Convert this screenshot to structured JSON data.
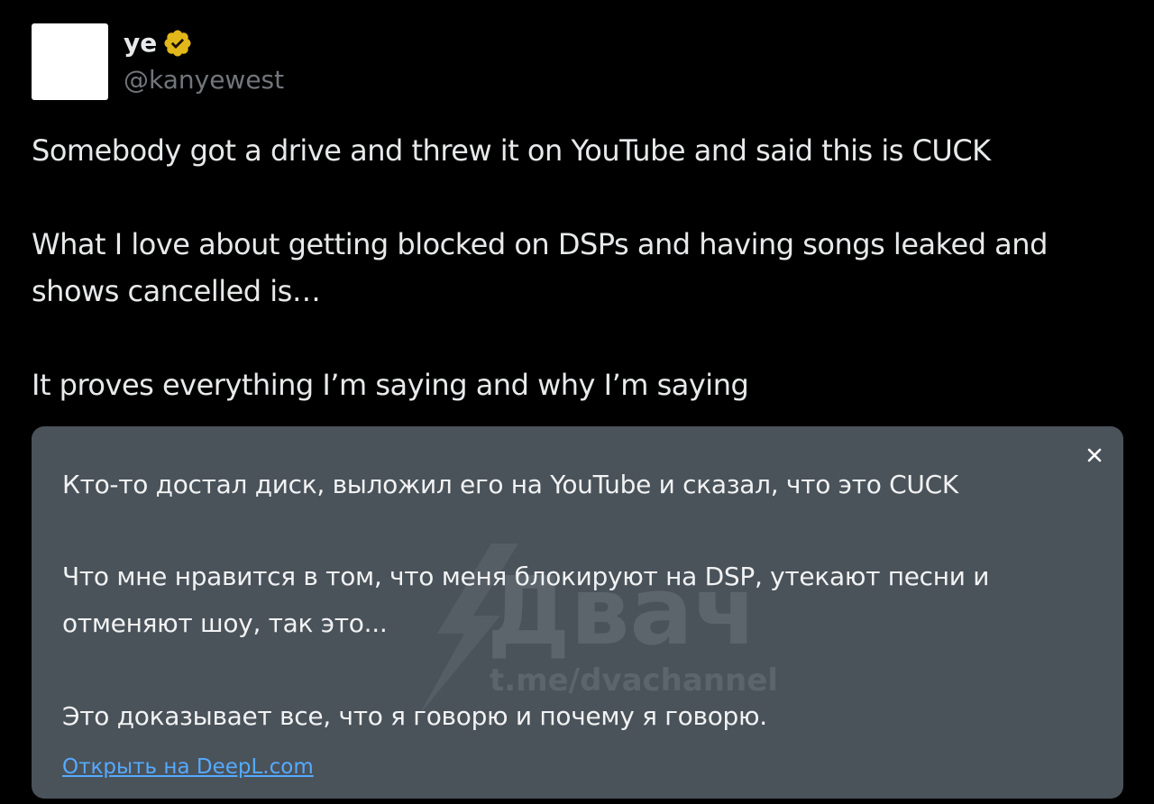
{
  "author": {
    "display_name": "ye",
    "handle": "@kanyewest",
    "verified_badge": "verified-badge-icon",
    "badge_color": "#e2b719"
  },
  "tweet": {
    "line1": "Somebody got a drive and threw it on YouTube and said this is CUCK",
    "line2": "What I love about getting blocked on DSPs and having songs leaked and",
    "line3": "shows cancelled is…",
    "line4": "It proves everything I’m saying and why I’m saying"
  },
  "translation": {
    "line1": "Кто-то достал диск, выложил его на YouTube и сказал, что это CUCK",
    "line2": "Что мне нравится в том, что меня блокируют на DSP, утекают песни и",
    "line3": "отменяют шоу, так это...",
    "line4": "Это доказывает все, что я говорю и почему я говорю.",
    "open_link": "Открыть на DeepL.com",
    "close_icon": "close-icon"
  },
  "watermark": {
    "logo_text": "Двач",
    "url": "t.me/dvachannel",
    "logo_icon": "lightning-bolt-icon"
  },
  "colors": {
    "background": "#000000",
    "text": "#e7e9ea",
    "muted": "#71767b",
    "panel": "#4a525a",
    "link": "#55aaff"
  }
}
